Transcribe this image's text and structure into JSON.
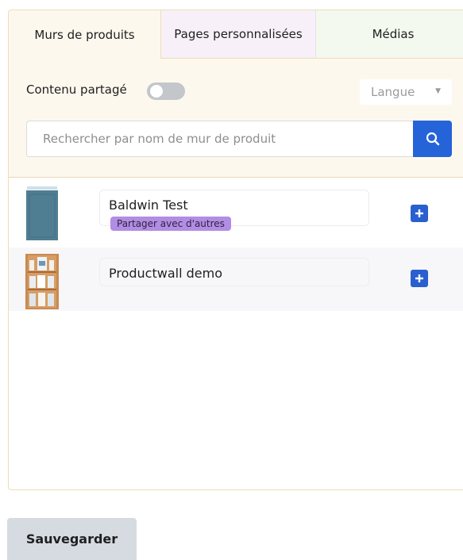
{
  "tabs": [
    {
      "label": "Murs de produits",
      "active": true
    },
    {
      "label": "Pages personnalisées",
      "active": false
    },
    {
      "label": "Médias",
      "active": false
    }
  ],
  "toolbar": {
    "shared_label": "Contenu partagé",
    "shared_on": false,
    "language_select": {
      "value": "Langue"
    }
  },
  "search": {
    "placeholder": "Rechercher par nom de mur de produit",
    "value": "",
    "icon": "search-icon"
  },
  "items": [
    {
      "name": "Baldwin Test",
      "badge": "Partager avec d'autres",
      "thumb": "door-thumbnail",
      "action_icon": "plus-icon"
    },
    {
      "name": "Productwall demo",
      "badge": "",
      "thumb": "shelf-thumbnail",
      "action_icon": "plus-icon"
    }
  ],
  "footer": {
    "save_label": "Sauvegarder"
  },
  "colors": {
    "accent": "#2563d9",
    "badge": "#b18de4",
    "toolbar_bg": "#fdf8ee",
    "border": "#f1dcb4"
  }
}
